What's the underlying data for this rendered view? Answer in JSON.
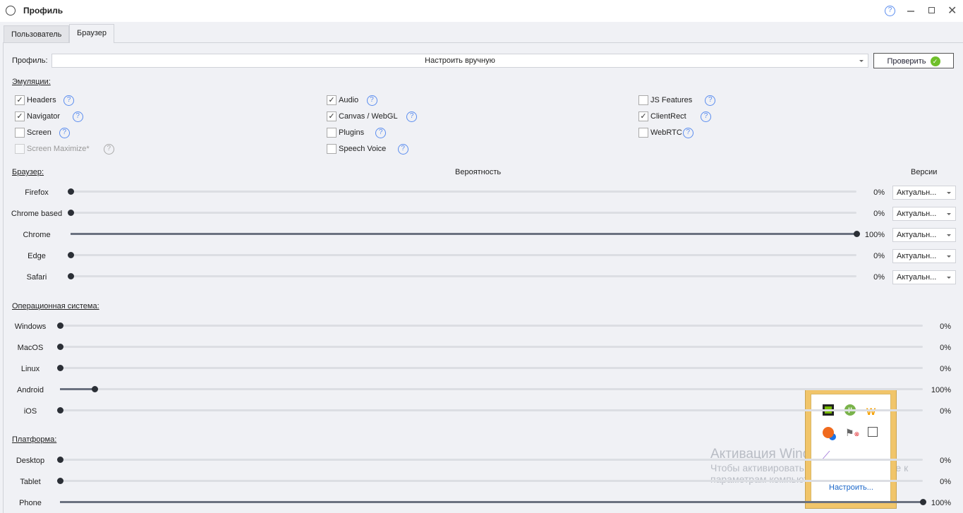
{
  "window": {
    "title": "Профиль"
  },
  "tabs": [
    {
      "label": "Пользователь"
    },
    {
      "label": "Браузер"
    }
  ],
  "profile": {
    "label": "Профиль:",
    "value": "Настроить вручную",
    "check_button": "Проверить"
  },
  "emulation": {
    "header": "Эмуляции:",
    "items": [
      {
        "label": "Headers",
        "checked": true
      },
      {
        "label": "Navigator",
        "checked": true
      },
      {
        "label": "Screen",
        "checked": false
      },
      {
        "label": "Screen Maximize*",
        "checked": false,
        "disabled": true
      },
      {
        "label": "Audio",
        "checked": true
      },
      {
        "label": "Canvas / WebGL",
        "checked": true
      },
      {
        "label": "Plugins",
        "checked": false
      },
      {
        "label": "Speech Voice",
        "checked": false
      },
      {
        "label": "JS Features",
        "checked": false
      },
      {
        "label": "ClientRect",
        "checked": true
      },
      {
        "label": "WebRTC",
        "checked": false
      }
    ]
  },
  "browser": {
    "header": "Браузер:",
    "probability_header": "Вероятность",
    "versions_header": "Версии",
    "rows": [
      {
        "label": "Firefox",
        "value": 0,
        "pct": "0%",
        "version": "Актуальн..."
      },
      {
        "label": "Chrome based",
        "value": 0,
        "pct": "0%",
        "version": "Актуальн..."
      },
      {
        "label": "Chrome",
        "value": 100,
        "pct": "100%",
        "version": "Актуальн..."
      },
      {
        "label": "Edge",
        "value": 0,
        "pct": "0%",
        "version": "Актуальн..."
      },
      {
        "label": "Safari",
        "value": 0,
        "pct": "0%",
        "version": "Актуальн..."
      }
    ]
  },
  "os": {
    "header": "Операционная система:",
    "rows": [
      {
        "label": "Windows",
        "value": 0,
        "pct": "0%"
      },
      {
        "label": "MacOS",
        "value": 0,
        "pct": "0%"
      },
      {
        "label": "Linux",
        "value": 0,
        "pct": "0%"
      },
      {
        "label": "Android",
        "value": 4,
        "pct": "100%"
      },
      {
        "label": "iOS",
        "value": 0,
        "pct": "0%"
      }
    ]
  },
  "platform": {
    "header": "Платформа:",
    "rows": [
      {
        "label": "Desktop",
        "value": 0,
        "pct": "0%"
      },
      {
        "label": "Tablet",
        "value": 0,
        "pct": "0%"
      },
      {
        "label": "Phone",
        "value": 100,
        "pct": "100%"
      }
    ]
  },
  "tray": {
    "customize": "Настроить..."
  },
  "watermark": {
    "title": "Активация Windows",
    "line1": "Чтобы активировать Windows, перейдите к",
    "line2": "параметрам компьютера."
  }
}
